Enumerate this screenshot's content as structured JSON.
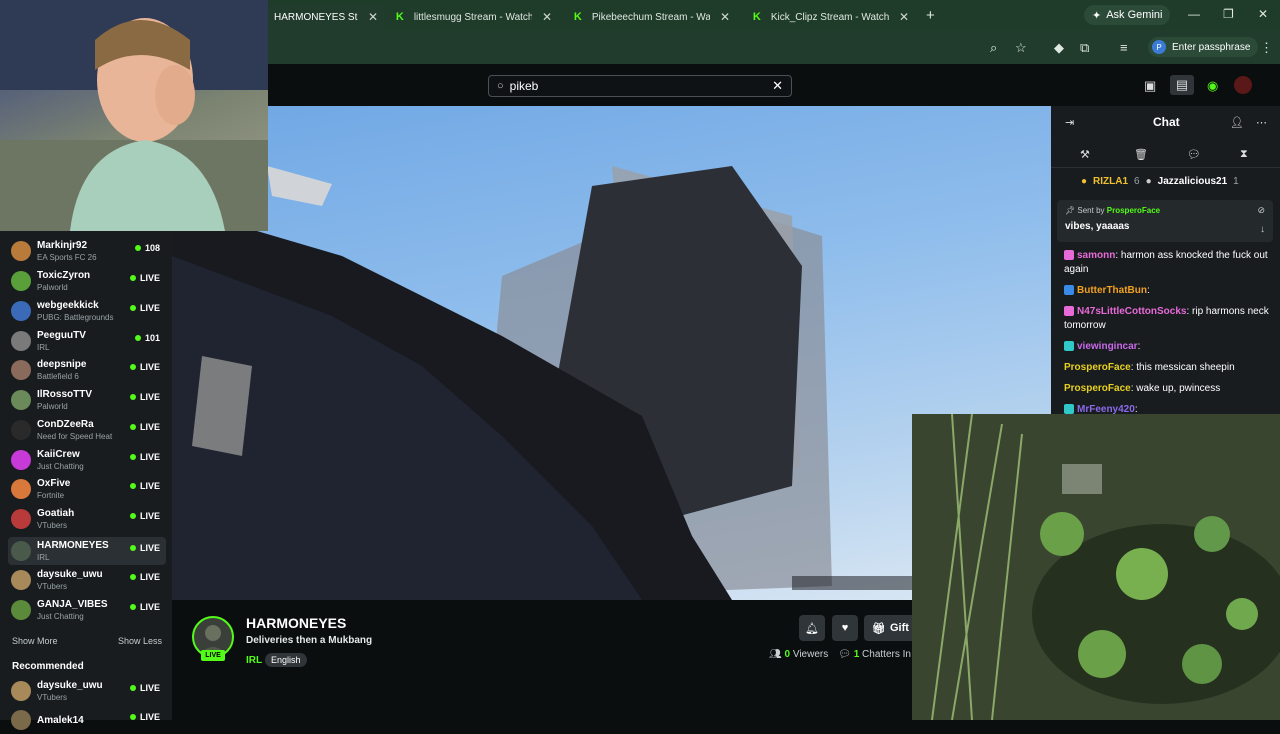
{
  "browser": {
    "tabs": [
      {
        "title": "HARMONEYES Stream - Watch Live on Kick",
        "active": true
      },
      {
        "title": "littlesmugg Stream - Watch Live on Kick"
      },
      {
        "title": "Pikebeechum Stream - Watch Live on Kick"
      },
      {
        "title": "Kick_Clipz Stream - Watch Live on Kick"
      }
    ],
    "ask_gemini": "Ask Gemini",
    "passphrase": "Enter passphrase",
    "profile_initial": "P"
  },
  "search": {
    "value": "pikeb"
  },
  "sidebar": {
    "following": [
      {
        "name": "Markinjr92",
        "category": "EA Sports FC 26",
        "status": "108",
        "color": "#b87b3a"
      },
      {
        "name": "ToxicZyron",
        "category": "Palworld",
        "status": "LIVE",
        "color": "#5aa03a"
      },
      {
        "name": "webgeekkick",
        "category": "PUBG: Battlegrounds",
        "status": "LIVE",
        "color": "#3a6ab8"
      },
      {
        "name": "PeeguuTV",
        "category": "IRL",
        "status": "101",
        "color": "#7a7a7a"
      },
      {
        "name": "deepsnipe",
        "category": "Battlefield 6",
        "status": "LIVE",
        "color": "#8a6a5a"
      },
      {
        "name": "IlRossoTTV",
        "category": "Palworld",
        "status": "LIVE",
        "color": "#6a8a5a"
      },
      {
        "name": "ConDZeeRa",
        "category": "Need for Speed Heat",
        "status": "LIVE",
        "color": "#2a2a2a"
      },
      {
        "name": "KaiiCrew",
        "category": "Just Chatting",
        "status": "LIVE",
        "color": "#c83ad8"
      },
      {
        "name": "OxFive",
        "category": "Fortnite",
        "status": "LIVE",
        "color": "#d8783a"
      },
      {
        "name": "Goatiah",
        "category": "VTubers",
        "status": "LIVE",
        "color": "#b83a3a"
      },
      {
        "name": "HARMONEYES",
        "category": "IRL",
        "status": "LIVE",
        "color": "#4a5a4a"
      },
      {
        "name": "daysuke_uwu",
        "category": "VTubers",
        "status": "LIVE",
        "color": "#a88a5a"
      },
      {
        "name": "GANJA_VIBES",
        "category": "Just Chatting",
        "status": "LIVE",
        "color": "#5a8a3a"
      }
    ],
    "show_more": "Show More",
    "show_less": "Show Less",
    "recommended_title": "Recommended",
    "recommended": [
      {
        "name": "daysuke_uwu",
        "category": "VTubers",
        "status": "LIVE",
        "color": "#a88a5a"
      },
      {
        "name": "Amalek14",
        "category": "",
        "status": "LIVE",
        "color": "#7a6a4a"
      }
    ]
  },
  "channel": {
    "name": "HARMONEYES",
    "title": "Deliveries then a Mukbang",
    "category": "IRL",
    "tag": "English",
    "live_label": "LIVE",
    "gift_label": "Gift S",
    "viewers_count": "0",
    "viewers_label": "Viewers",
    "chatters_count": "1",
    "chatters_label": "Chatters In"
  },
  "chat": {
    "title": "Chat",
    "top_users": [
      {
        "name": "RIZLA1",
        "count": "6"
      },
      {
        "name": "Jazzalicious21",
        "count": "1"
      }
    ],
    "pinned": {
      "sent_by_label": "Sent by",
      "sender": "ProsperoFace",
      "message": "vibes, yaaaas"
    },
    "messages": [
      {
        "user": "samonn",
        "color": "#e86ad8",
        "text": "harmon ass knocked the fuck out again"
      },
      {
        "user": "ButterThatBun",
        "color": "#f0a020",
        "text": ""
      },
      {
        "user": "N47sLittleCottonSocks",
        "color": "#e86ad8",
        "text": "rip harmons neck tomorrow"
      },
      {
        "user": "viewingincar",
        "color": "#c86ae8",
        "text": ""
      },
      {
        "user": "ProsperoFace",
        "color": "#e8d020",
        "text": "this messican sheepin"
      },
      {
        "user": "ProsperoFace",
        "color": "#e8d020",
        "text": "wake up, pwincess"
      },
      {
        "user": "MrFeeny420",
        "color": "#8a6ae8",
        "text": ""
      }
    ]
  }
}
